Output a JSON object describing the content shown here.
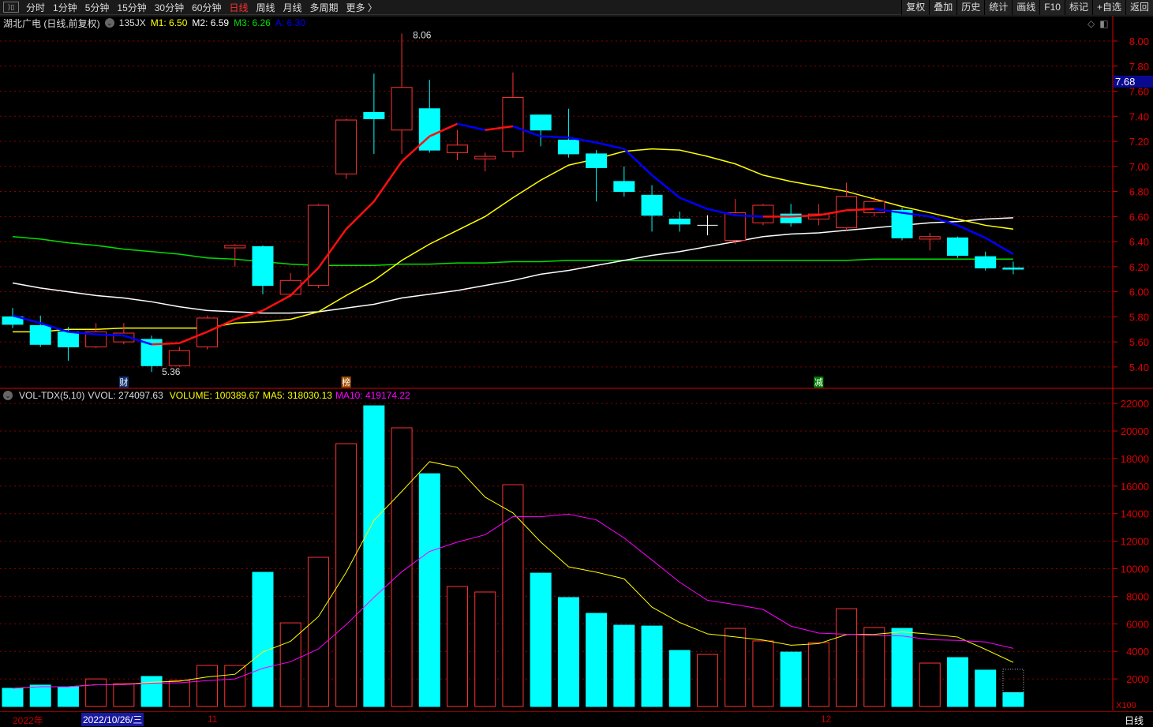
{
  "topbar": {
    "periods": [
      "分时",
      "1分钟",
      "5分钟",
      "15分钟",
      "30分钟",
      "60分钟",
      "日线",
      "周线",
      "月线",
      "多周期",
      "更多 〉"
    ],
    "active": "日线",
    "actions": [
      "复权",
      "叠加",
      "历史",
      "统计",
      "画线",
      "F10",
      "标记",
      "+自选",
      "返回"
    ]
  },
  "price_header": {
    "title": "湖北广电 (日线,前复权)",
    "indicator": "135JX",
    "m1": "M1: 6.50",
    "m2": "M2: 6.59",
    "m3": "M3: 6.26",
    "a": "A: 6.30"
  },
  "colors": {
    "up": "#ff3232",
    "down": "#00ffff",
    "m1": "#ffff00",
    "m2": "#ffffff",
    "m3": "#00e000",
    "a": "#0000ff",
    "grid": "#8b0000",
    "axis": "#e00000",
    "ma5": "#ffff00",
    "ma10": "#ff00ff"
  },
  "price_axis": {
    "ticks": [
      "8.00",
      "7.80",
      "7.60",
      "7.40",
      "7.20",
      "7.00",
      "6.80",
      "6.60",
      "6.40",
      "6.20",
      "6.00",
      "5.80",
      "5.60",
      "5.40"
    ],
    "current": "7.68",
    "high_label": "8.06",
    "low_label": "5.36"
  },
  "markers": [
    {
      "text": "财",
      "bg": "#103070",
      "index": 4
    },
    {
      "text": "榜",
      "bg": "#a05000",
      "index": 12
    },
    {
      "text": "减",
      "bg": "#008000",
      "index": 29
    }
  ],
  "chart_data": {
    "type": "candlestick",
    "ylim": [
      5.3,
      8.1
    ],
    "candles": [
      [
        5.8,
        5.74,
        5.87,
        5.71
      ],
      [
        5.73,
        5.58,
        5.81,
        5.56
      ],
      [
        5.68,
        5.56,
        5.72,
        5.45
      ],
      [
        5.56,
        5.68,
        5.75,
        5.55
      ],
      [
        5.6,
        5.67,
        5.75,
        5.58
      ],
      [
        5.62,
        5.41,
        5.65,
        5.36
      ],
      [
        5.41,
        5.53,
        5.56,
        5.4
      ],
      [
        5.56,
        5.79,
        5.81,
        5.54
      ],
      [
        6.35,
        6.37,
        6.38,
        6.2
      ],
      [
        6.36,
        6.05,
        6.37,
        5.98
      ],
      [
        5.98,
        6.09,
        6.15,
        5.96
      ],
      [
        6.05,
        6.69,
        6.7,
        6.03
      ],
      [
        6.94,
        7.37,
        7.38,
        6.9
      ],
      [
        7.43,
        7.38,
        7.74,
        7.1
      ],
      [
        7.29,
        7.63,
        8.06,
        7.1
      ],
      [
        7.46,
        7.13,
        7.69,
        7.11
      ],
      [
        7.11,
        7.17,
        7.29,
        7.05
      ],
      [
        7.06,
        7.08,
        7.11,
        6.96
      ],
      [
        7.12,
        7.55,
        7.75,
        7.07
      ],
      [
        7.41,
        7.29,
        7.41,
        7.16
      ],
      [
        7.21,
        7.1,
        7.46,
        7.07
      ],
      [
        7.1,
        6.99,
        7.13,
        6.72
      ],
      [
        6.88,
        6.8,
        7.0,
        6.76
      ],
      [
        6.77,
        6.61,
        6.85,
        6.48
      ],
      [
        6.58,
        6.54,
        6.64,
        6.48
      ],
      [
        6.53,
        6.53,
        6.61,
        6.45
      ],
      [
        6.41,
        6.63,
        6.74,
        6.38
      ],
      [
        6.55,
        6.69,
        6.7,
        6.53
      ],
      [
        6.62,
        6.55,
        6.7,
        6.52
      ],
      [
        6.58,
        6.62,
        6.7,
        6.53
      ],
      [
        6.51,
        6.76,
        6.87,
        6.49
      ],
      [
        6.63,
        6.72,
        6.76,
        6.6
      ],
      [
        6.65,
        6.43,
        6.67,
        6.41
      ],
      [
        6.42,
        6.44,
        6.47,
        6.33
      ],
      [
        6.43,
        6.29,
        6.44,
        6.27
      ],
      [
        6.28,
        6.19,
        6.32,
        6.17
      ],
      [
        6.19,
        6.18,
        6.24,
        6.14
      ]
    ],
    "lines": {
      "m1": [
        5.68,
        5.68,
        5.7,
        5.7,
        5.71,
        5.71,
        5.71,
        5.71,
        5.75,
        5.76,
        5.78,
        5.84,
        5.97,
        6.09,
        6.25,
        6.38,
        6.49,
        6.6,
        6.75,
        6.89,
        7.01,
        7.06,
        7.12,
        7.14,
        7.13,
        7.08,
        7.02,
        6.93,
        6.88,
        6.84,
        6.8,
        6.74,
        6.68,
        6.63,
        6.58,
        6.53,
        6.5
      ],
      "m2": [
        6.07,
        6.03,
        6.0,
        5.97,
        5.95,
        5.92,
        5.88,
        5.85,
        5.84,
        5.83,
        5.83,
        5.84,
        5.87,
        5.9,
        5.95,
        5.98,
        6.01,
        6.05,
        6.09,
        6.14,
        6.17,
        6.21,
        6.25,
        6.29,
        6.32,
        6.36,
        6.4,
        6.44,
        6.46,
        6.47,
        6.49,
        6.51,
        6.53,
        6.55,
        6.56,
        6.58,
        6.59
      ],
      "m3": [
        6.44,
        6.42,
        6.39,
        6.37,
        6.34,
        6.32,
        6.3,
        6.27,
        6.26,
        6.24,
        6.22,
        6.21,
        6.21,
        6.21,
        6.22,
        6.22,
        6.23,
        6.23,
        6.24,
        6.24,
        6.25,
        6.25,
        6.25,
        6.25,
        6.25,
        6.25,
        6.25,
        6.25,
        6.25,
        6.25,
        6.25,
        6.26,
        6.26,
        6.26,
        6.26,
        6.26,
        6.26
      ],
      "a": [
        5.81,
        5.75,
        5.68,
        5.66,
        5.65,
        5.58,
        5.59,
        5.68,
        5.78,
        5.85,
        5.97,
        6.19,
        6.5,
        6.72,
        7.04,
        7.24,
        7.34,
        7.29,
        7.32,
        7.24,
        7.23,
        7.19,
        7.14,
        6.93,
        6.75,
        6.66,
        6.61,
        6.6,
        6.6,
        6.61,
        6.65,
        6.66,
        6.63,
        6.6,
        6.53,
        6.43,
        6.3
      ]
    },
    "volume": {
      "unit": "X100",
      "ylim": [
        0,
        22500
      ],
      "ticks": [
        "22000",
        "20000",
        "18000",
        "16000",
        "14000",
        "12000",
        "10000",
        "8000",
        "6000",
        "4000",
        "2000"
      ],
      "values": [
        1320,
        1550,
        1430,
        2000,
        1660,
        2180,
        1890,
        2980,
        2980,
        9740,
        6070,
        10830,
        19080,
        21830,
        20230,
        16900,
        8710,
        8310,
        16100,
        9680,
        7910,
        6760,
        5900,
        5840,
        4070,
        3780,
        5670,
        4760,
        3950,
        4640,
        7100,
        5730,
        5670,
        3150,
        3550,
        2640,
        1004
      ],
      "projected_last": 2700
    }
  },
  "vol_header": {
    "name": "VOL-TDX(5,10)",
    "vvol": "VVOL: 274097.63",
    "volume": "VOLUME: 100389.67",
    "ma5": "MA5: 318030.13",
    "ma10": "MA10: 419174.22"
  },
  "bottom": {
    "year": "2022年",
    "date": "2022/10/26/三",
    "m11": "11",
    "m12": "12",
    "period": "日线",
    "unit": "X100"
  }
}
